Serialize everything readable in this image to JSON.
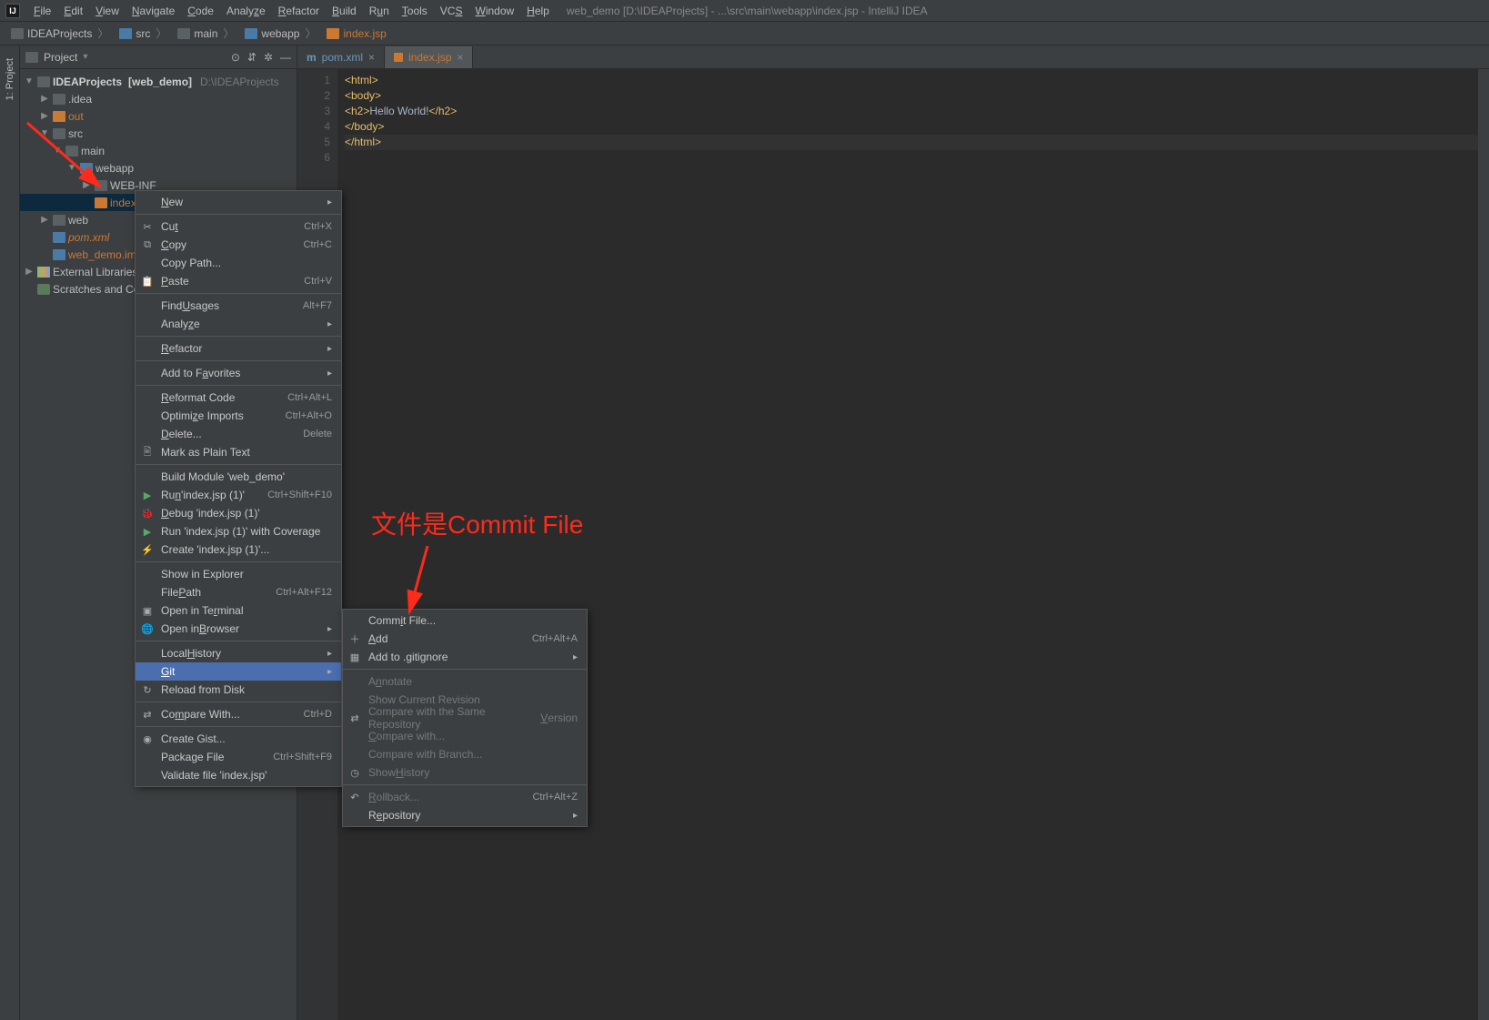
{
  "window": {
    "title": "web_demo [D:\\IDEAProjects] - ...\\src\\main\\webapp\\index.jsp - IntelliJ IDEA"
  },
  "menu": {
    "file": "File",
    "edit": "Edit",
    "view": "View",
    "navigate": "Navigate",
    "code": "Code",
    "analyze": "Analyze",
    "refactor": "Refactor",
    "build": "Build",
    "run": "Run",
    "tools": "Tools",
    "vcs": "VCS",
    "window": "Window",
    "help": "Help"
  },
  "breadcrumb": {
    "root": "IDEAProjects",
    "src": "src",
    "main": "main",
    "webapp": "webapp",
    "file": "index.jsp"
  },
  "sidebar": {
    "title": "Project",
    "vtab": "1: Project",
    "root": "IDEAProjects",
    "root_tag": "[web_demo]",
    "root_path": "D:\\IDEAProjects",
    "idea": ".idea",
    "out": "out",
    "src": "src",
    "main": "main",
    "webapp": "webapp",
    "webinf": "WEB-INF",
    "indexjsp": "index.jsp",
    "web": "web",
    "pom": "pom.xml",
    "iml": "web_demo.iml",
    "ext": "External Libraries",
    "scr": "Scratches and Consoles"
  },
  "tabs": {
    "pom": "pom.xml",
    "index": "index.jsp"
  },
  "code": {
    "l1": "<html>",
    "l2": "<body>",
    "l3a": "<h2>",
    "l3b": "Hello World!",
    "l3c": "</h2>",
    "l4": "</body>",
    "l5": "</html>"
  },
  "ctx": {
    "new": "New",
    "cut": "Cut",
    "cut_sc": "Ctrl+X",
    "copy": "Copy",
    "copy_sc": "Ctrl+C",
    "copy_path": "Copy Path...",
    "paste": "Paste",
    "paste_sc": "Ctrl+V",
    "find": "Find Usages",
    "find_sc": "Alt+F7",
    "analyze": "Analyze",
    "refactor": "Refactor",
    "fav": "Add to Favorites",
    "reformat": "Reformat Code",
    "reformat_sc": "Ctrl+Alt+L",
    "optimize": "Optimize Imports",
    "optimize_sc": "Ctrl+Alt+O",
    "delete": "Delete...",
    "delete_sc": "Delete",
    "plain": "Mark as Plain Text",
    "build_mod": "Build Module 'web_demo'",
    "run_jsp": "Run 'index.jsp (1)'",
    "run_jsp_sc": "Ctrl+Shift+F10",
    "debug_jsp": "Debug 'index.jsp (1)'",
    "cov_jsp": "Run 'index.jsp (1)' with Coverage",
    "create_jsp": "Create 'index.jsp (1)'...",
    "explorer": "Show in Explorer",
    "file_path": "File Path",
    "file_path_sc": "Ctrl+Alt+F12",
    "terminal": "Open in Terminal",
    "browser": "Open in Browser",
    "local_hist": "Local History",
    "git": "Git",
    "reload": "Reload from Disk",
    "compare": "Compare With...",
    "compare_sc": "Ctrl+D",
    "gist": "Create Gist...",
    "package": "Package File",
    "package_sc": "Ctrl+Shift+F9",
    "validate": "Validate file 'index.jsp'"
  },
  "git": {
    "commit": "Commit File...",
    "add": "Add",
    "add_sc": "Ctrl+Alt+A",
    "gitignore": "Add to .gitignore",
    "annotate": "Annotate",
    "show_rev": "Show Current Revision",
    "cmp_repo": "Compare with the Same Repository Version",
    "cmp_with": "Compare with...",
    "cmp_branch": "Compare with Branch...",
    "show_hist": "Show History",
    "rollback": "Rollback...",
    "rollback_sc": "Ctrl+Alt+Z",
    "repository": "Repository"
  },
  "annot": {
    "text": "文件是Commit File"
  }
}
